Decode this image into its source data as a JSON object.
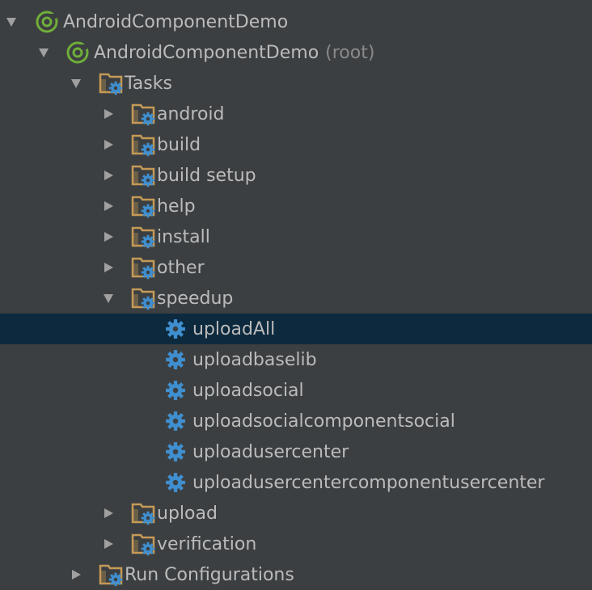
{
  "tree": {
    "root_label": "AndroidComponentDemo",
    "project_label": "AndroidComponentDemo",
    "project_suffix": "(root)",
    "tasks_label": "Tasks",
    "groups": {
      "android": "android",
      "build": "build",
      "build_setup": "build setup",
      "help": "help",
      "install": "install",
      "other": "other",
      "speedup": "speedup",
      "upload": "upload",
      "verification": "verification"
    },
    "speedup_tasks": {
      "uploadAll": "uploadAll",
      "uploadbaselib": "uploadbaselib",
      "uploadsocial": "uploadsocial",
      "uploadsocialcomponentsocial": "uploadsocialcomponentsocial",
      "uploadusercenter": "uploadusercenter",
      "uploadusercentercomponentusercenter": "uploadusercentercomponentusercenter"
    },
    "run_configurations_label": "Run Configurations",
    "selected_item": "uploadAll"
  },
  "colors": {
    "background": "#3c3f41",
    "selection": "#0d293e",
    "text": "#bbbbbb",
    "muted_text": "#8a8a8a",
    "gradle_green": "#6fae3a",
    "folder": "#c59a57",
    "gear_blue": "#3f8fd0"
  },
  "icons": {
    "expand": "triangle-down-icon",
    "collapse": "triangle-right-icon",
    "gradle": "gradle-elephant-icon",
    "task_folder": "folder-gear-icon",
    "task": "gear-icon"
  }
}
